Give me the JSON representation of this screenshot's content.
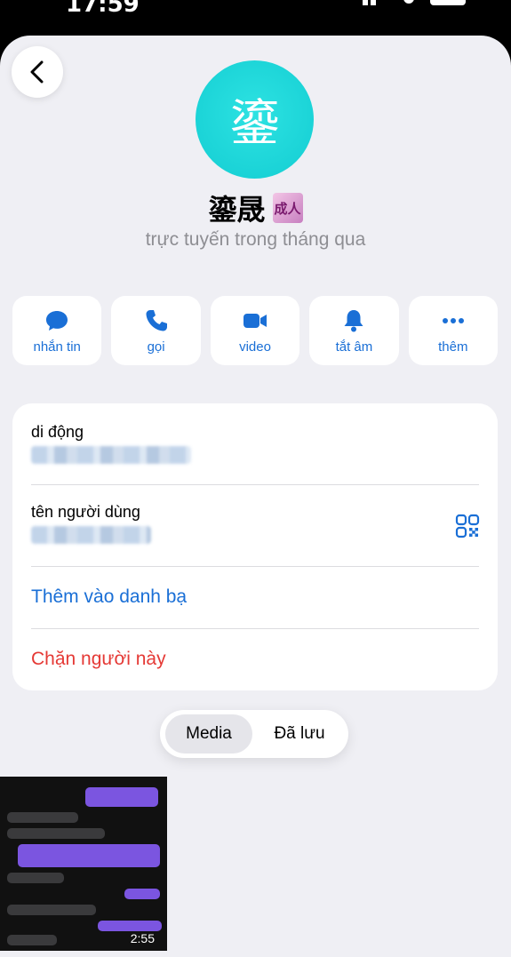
{
  "status_bar": {
    "time": "17:59"
  },
  "profile": {
    "avatar_char": "鎏",
    "name": "鎏晟",
    "badge_text": "成人",
    "status": "trực tuyến trong tháng qua"
  },
  "actions": [
    {
      "label": "nhắn tin",
      "icon": "message-icon"
    },
    {
      "label": "gọi",
      "icon": "phone-icon"
    },
    {
      "label": "video",
      "icon": "video-icon"
    },
    {
      "label": "tắt âm",
      "icon": "bell-icon"
    },
    {
      "label": "thêm",
      "icon": "more-icon"
    }
  ],
  "info": {
    "mobile_label": "di động",
    "username_label": "tên người dùng",
    "add_contact": "Thêm vào danh bạ",
    "block": "Chặn người này"
  },
  "tabs": {
    "media": "Media",
    "saved": "Đã lưu"
  },
  "media": {
    "duration": "2:55"
  },
  "colors": {
    "accent": "#1a6fd6",
    "danger": "#e53935",
    "avatar": "#13cdd2"
  }
}
